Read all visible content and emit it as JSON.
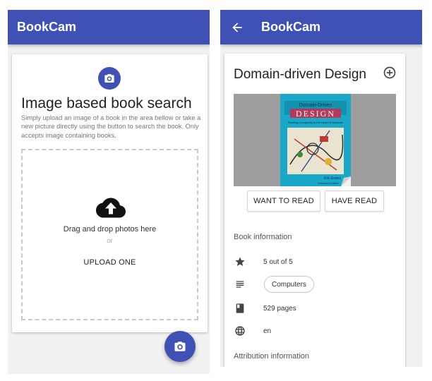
{
  "left_screen": {
    "app_title": "BookCam",
    "search": {
      "title": "Image based book search",
      "description": "Simply upload an image of a book in the area bellow or take a new picture directly using the button to search the book. Only accepts image containing books."
    },
    "dropzone": {
      "main_text": "Drag and drop photos here",
      "or_text": "or",
      "upload_label": "UPLOAD ONE"
    }
  },
  "right_screen": {
    "app_title": "BookCam",
    "book": {
      "title": "Domain-driven Design",
      "cover_lines": [
        "Domain-Driven",
        "DESIGN",
        "Tackling Complexity in the Heart of Software",
        "Eric Evans",
        "Foreword by Martin"
      ]
    },
    "buttons": {
      "want_to_read": "WANT TO READ",
      "have_read": "HAVE READ"
    },
    "book_information": {
      "heading": "Book information",
      "rating": "5 out of 5",
      "category": "Computers",
      "pages": "529 pages",
      "language": "en"
    },
    "attribution_heading": "Attribution information"
  },
  "colors": {
    "primary": "#3f51b5",
    "background": "#f1f1f1",
    "card": "#ffffff",
    "cover_placeholder": "#9e9e9e",
    "cover_art": "#1ba7c8"
  },
  "icons": {
    "left_card_top": "camera-icon",
    "dropzone": "cloud-upload-icon",
    "fab": "camera-icon",
    "back": "arrow-back-icon",
    "add": "add-circle-outline-icon",
    "rating": "star-icon",
    "category": "subject-icon",
    "pages": "book-icon",
    "language": "globe-icon"
  }
}
